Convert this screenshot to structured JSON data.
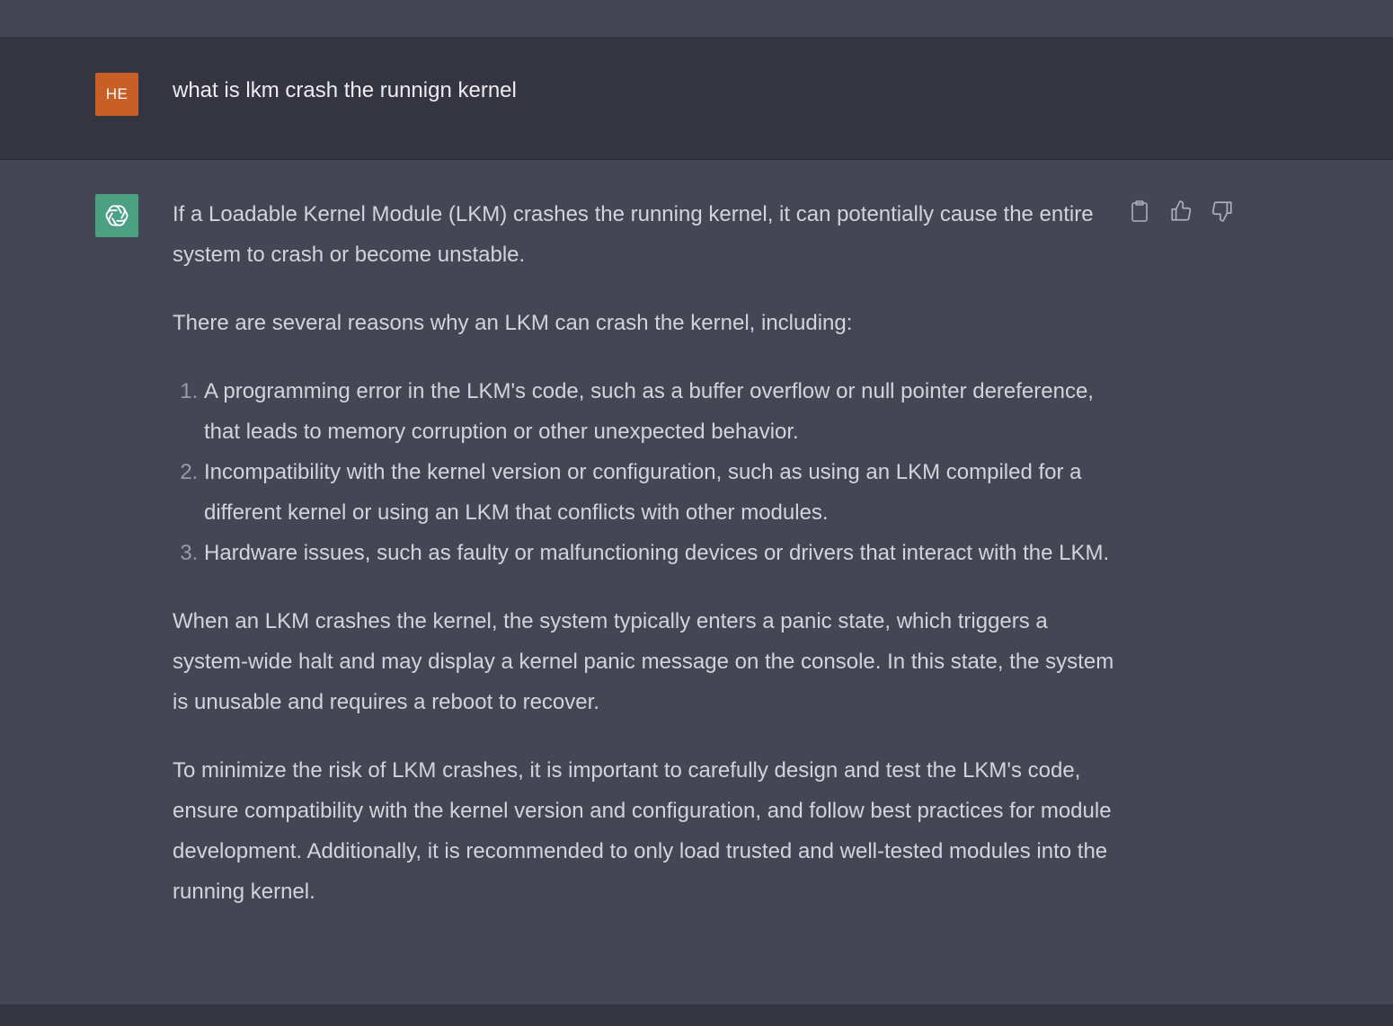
{
  "colors": {
    "user_avatar_bg": "#c95f27",
    "bot_avatar_bg": "#4aa081",
    "user_row_bg": "#343541",
    "assistant_row_bg": "#444654"
  },
  "user_message": {
    "avatar_initials": "HE",
    "text": "what is lkm crash the runnign kernel"
  },
  "assistant_message": {
    "avatar_icon": "openai-logo-icon",
    "paragraphs": [
      "If a Loadable Kernel Module (LKM) crashes the running kernel, it can potentially cause the entire system to crash or become unstable.",
      "There are several reasons why an LKM can crash the kernel, including:"
    ],
    "list": [
      "A programming error in the LKM's code, such as a buffer overflow or null pointer dereference, that leads to memory corruption or other unexpected behavior.",
      "Incompatibility with the kernel version or configuration, such as using an LKM compiled for a different kernel or using an LKM that conflicts with other modules.",
      "Hardware issues, such as faulty or malfunctioning devices or drivers that interact with the LKM."
    ],
    "closing_paragraphs": [
      "When an LKM crashes the kernel, the system typically enters a panic state, which triggers a system-wide halt and may display a kernel panic message on the console. In this state, the system is unusable and requires a reboot to recover.",
      "To minimize the risk of LKM crashes, it is important to carefully design and test the LKM's code, ensure compatibility with the kernel version and configuration, and follow best practices for module development. Additionally, it is recommended to only load trusted and well-tested modules into the running kernel."
    ]
  },
  "actions": {
    "copy_icon": "clipboard-icon",
    "like_icon": "thumbs-up-icon",
    "dislike_icon": "thumbs-down-icon"
  }
}
